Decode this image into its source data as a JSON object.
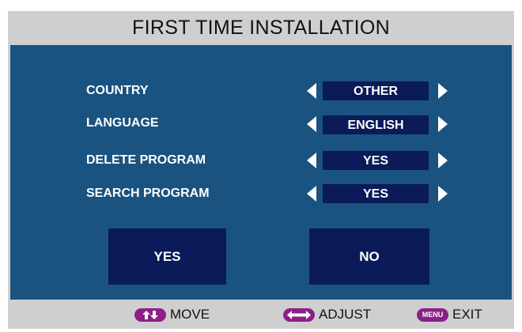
{
  "title": "FIRST TIME INSTALLATION",
  "settings": [
    {
      "label": "COUNTRY",
      "value": "OTHER"
    },
    {
      "label": "LANGUAGE",
      "value": "ENGLISH"
    },
    {
      "label": "DELETE PROGRAM",
      "value": "YES"
    },
    {
      "label": "SEARCH PROGRAM",
      "value": "YES"
    }
  ],
  "buttons": {
    "yes": "YES",
    "no": "NO"
  },
  "footer": {
    "move_label": "MOVE",
    "adjust_label": "ADJUST",
    "menu_key_label": "MENU",
    "exit_label": "EXIT"
  },
  "icons": {
    "left": "left-arrow-icon",
    "right": "right-arrow-icon",
    "move": "up-down-arrows-icon",
    "adjust": "left-right-arrow-icon"
  },
  "colors": {
    "panel": "#1a5380",
    "value_box": "#0b1a59",
    "frame": "#cfcfcf",
    "key_pill": "#8c1f8a",
    "text_light": "#ffffff",
    "text_dark": "#111111"
  }
}
